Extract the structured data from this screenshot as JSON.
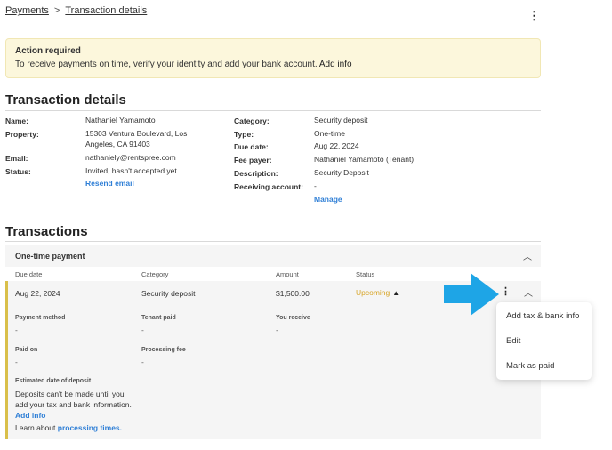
{
  "breadcrumb": {
    "parent": "Payments",
    "separator": ">",
    "current": "Transaction details"
  },
  "alert": {
    "title": "Action required",
    "message": "To receive payments on time, verify your identity and add your bank account.",
    "link": "Add info"
  },
  "details": {
    "heading": "Transaction details",
    "left": {
      "name_label": "Name:",
      "name_value": "Nathaniel Yamamoto",
      "property_label": "Property:",
      "property_line1": "15303 Ventura Boulevard, Los",
      "property_line2": "Angeles, CA 91403",
      "email_label": "Email:",
      "email_value": "nathaniely@rentspree.com",
      "status_label": "Status:",
      "status_value": "Invited, hasn't accepted yet",
      "resend": "Resend email"
    },
    "right": {
      "category_label": "Category:",
      "category_value": "Security deposit",
      "type_label": "Type:",
      "type_value": "One-time",
      "due_label": "Due date:",
      "due_value": "Aug 22, 2024",
      "fee_label": "Fee payer:",
      "fee_value": "Nathaniel Yamamoto (Tenant)",
      "desc_label": "Description:",
      "desc_value": "Security Deposit",
      "receiving_label": "Receiving account:",
      "receiving_value": "-",
      "manage": "Manage"
    }
  },
  "transactions": {
    "heading": "Transactions",
    "section_title": "One-time payment",
    "columns": [
      "Due date",
      "Category",
      "Amount",
      "Status"
    ],
    "row": {
      "due": "Aug 22, 2024",
      "category": "Security deposit",
      "amount": "$1,500.00",
      "status": "Upcoming"
    },
    "expanded": {
      "payment_method_label": "Payment method",
      "payment_method_value": "-",
      "tenant_paid_label": "Tenant paid",
      "tenant_paid_value": "-",
      "you_receive_label": "You receive",
      "you_receive_value": "-",
      "paid_on_label": "Paid on",
      "paid_on_value": "-",
      "processing_fee_label": "Processing fee",
      "processing_fee_value": "-",
      "estimated_label": "Estimated date of deposit",
      "estimated_line1": "Deposits can't be made until you",
      "estimated_line2": "add your tax and bank information.",
      "add_info": "Add info",
      "learn_prefix": "Learn about",
      "learn_link": "processing times."
    }
  },
  "menu": {
    "items": [
      "Add tax & bank info",
      "Edit",
      "Mark as paid"
    ]
  },
  "colors": {
    "accent_link": "#2f7fd6",
    "alert_bg": "#fcf7dc",
    "status_upcoming": "#d8a62a",
    "arrow": "#1ea5e6",
    "row_bar": "#d9bf4a"
  }
}
